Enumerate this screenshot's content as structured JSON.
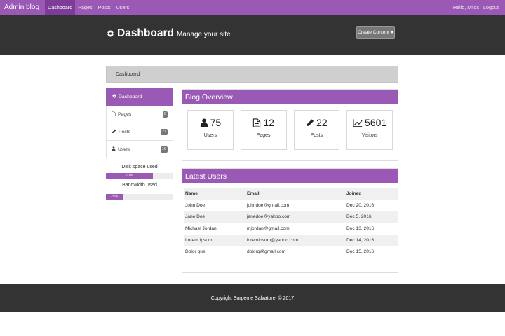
{
  "nav": {
    "brand": "Admin blog",
    "links": [
      "Dashboard",
      "Pages",
      "Posts",
      "Users"
    ],
    "greeting": "Hello, Milos",
    "logout": "Logout"
  },
  "header": {
    "title": "Dashboard",
    "subtitle": "Manage your site",
    "create_button": "Create Content"
  },
  "breadcrumb": "Dashboard",
  "sidebar": {
    "items": [
      {
        "label": "Dashboard",
        "icon": "gear-icon"
      },
      {
        "label": "Pages",
        "icon": "page-icon",
        "count": "0"
      },
      {
        "label": "Posts",
        "icon": "pencil-icon",
        "count": "27"
      },
      {
        "label": "Users",
        "icon": "user-icon",
        "count": "16"
      }
    ],
    "disk_label": "Disk space used",
    "disk_percent_text": "70%",
    "disk_percent": 70,
    "bandwidth_label": "Bandwidth used",
    "bandwidth_percent_text": "25%",
    "bandwidth_percent": 25
  },
  "overview": {
    "title": "Blog Overview",
    "cards": [
      {
        "value": "75",
        "label": "Users",
        "icon": "user-icon"
      },
      {
        "value": "12",
        "label": "Pages",
        "icon": "page-icon"
      },
      {
        "value": "22",
        "label": "Posts",
        "icon": "pencil-icon"
      },
      {
        "value": "5601",
        "label": "Visitors",
        "icon": "chart-line-icon"
      }
    ]
  },
  "latest_users": {
    "title": "Latest Users",
    "columns": [
      "Name",
      "Email",
      "Joined"
    ],
    "rows": [
      [
        "John Doe",
        "johndoe@gmail.com",
        "Dec 20, 2016"
      ],
      [
        "Jane Doe",
        "janedoe@yahoo.com",
        "Dec 5, 2016"
      ],
      [
        "Michael Jordan",
        "mjordan@gmail.com",
        "Dec 13, 2016"
      ],
      [
        "Lorem Ipsum",
        "loremipsum@yahoo.com",
        "Dec 14, 2016"
      ],
      [
        "Dolor que",
        "dolorq@gmail.com",
        "Dec 15, 2016"
      ]
    ]
  },
  "footer": "Copyright Surpeme Salvatore, © 2017",
  "colors": {
    "accent": "#9b59b6",
    "dark": "#333333"
  }
}
